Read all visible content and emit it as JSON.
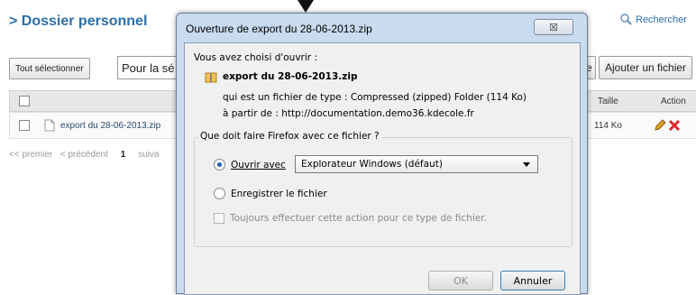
{
  "background": {
    "title": "> Dossier personnel",
    "search_label": "Rechercher",
    "select_all_button": "Tout sélectionner",
    "action_select_partial": "Pour la sé",
    "add_file_button": "Ajouter un fichier",
    "partial_button": "e",
    "table": {
      "col_size": "Taille",
      "col_action": "Action",
      "row": {
        "name": "export du 28-06-2013.zip",
        "size": "114 Ko"
      }
    },
    "pager": {
      "first": "<< premier",
      "prev": "< précédent",
      "page": "1",
      "next": "suiva"
    }
  },
  "dialog": {
    "title": "Ouverture de export du 28-06-2013.zip",
    "close_glyph": "☒",
    "intro": "Vous avez choisi d'ouvrir :",
    "filename": "export du 28-06-2013.zip",
    "type_label": "qui est un fichier de type :",
    "type_value": "Compressed (zipped) Folder (114 Ko)",
    "from_label": "à partir de :",
    "from_value": "http://documentation.demo36.kdecole.fr",
    "question": "Que doit faire Firefox avec ce fichier ?",
    "open_with_label": "Ouvrir avec",
    "open_with_value": "Explorateur Windows (défaut)",
    "save_label": "Enregistrer le fichier",
    "always_label": "Toujours effectuer cette action pour ce type de fichier.",
    "ok_button": "OK",
    "cancel_button": "Annuler"
  },
  "colors": {
    "link_blue": "#2a6ea8",
    "delete_red": "#d8282a",
    "edit_pencil": "#e0a020"
  }
}
